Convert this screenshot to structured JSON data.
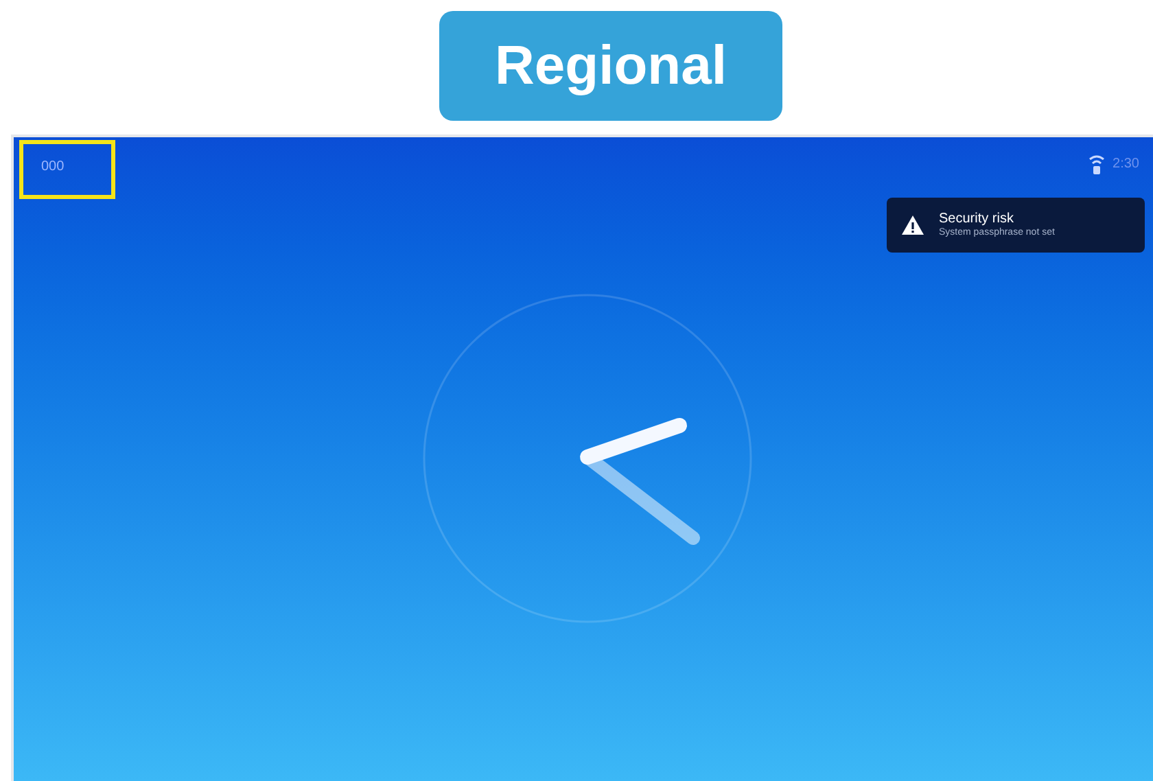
{
  "header": {
    "label": "Regional"
  },
  "screen": {
    "room_id": "000",
    "room_id_highlighted": true,
    "time": "2:30",
    "notification": {
      "kind": "warning",
      "title": "Security risk",
      "message": "System passphrase not set"
    }
  }
}
